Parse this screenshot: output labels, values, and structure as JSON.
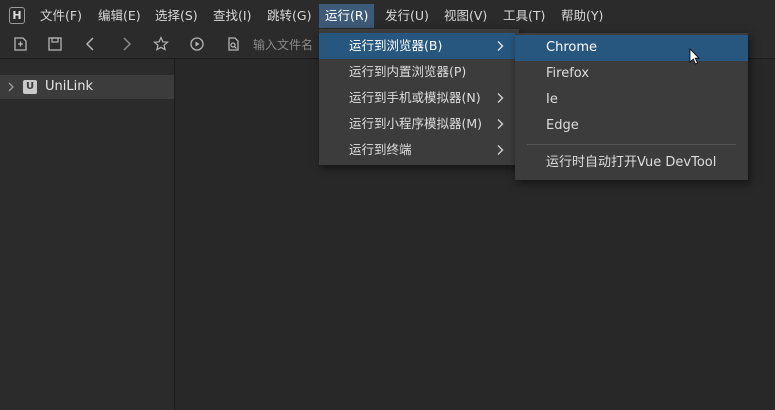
{
  "app": {
    "logo_text": "H"
  },
  "menubar": {
    "items": [
      {
        "label": "文件(F)"
      },
      {
        "label": "编辑(E)"
      },
      {
        "label": "选择(S)"
      },
      {
        "label": "查找(I)"
      },
      {
        "label": "跳转(G)"
      },
      {
        "label": "运行(R)",
        "active": true
      },
      {
        "label": "发行(U)"
      },
      {
        "label": "视图(V)"
      },
      {
        "label": "工具(T)"
      },
      {
        "label": "帮助(Y)"
      }
    ]
  },
  "toolbar": {
    "file_input_placeholder": "输入文件名",
    "icons": [
      "new-file-icon",
      "save-icon",
      "back-icon",
      "forward-icon",
      "star-icon",
      "run-icon",
      "search-file-icon"
    ]
  },
  "sidebar": {
    "project": {
      "name": "UniLink",
      "icon_letter": "U",
      "expanded": false
    }
  },
  "run_menu": {
    "items": [
      {
        "label": "运行到浏览器(B)",
        "has_submenu": true,
        "active": true
      },
      {
        "label": "运行到内置浏览器(P)",
        "has_submenu": false
      },
      {
        "label": "运行到手机或模拟器(N)",
        "has_submenu": true
      },
      {
        "label": "运行到小程序模拟器(M)",
        "has_submenu": true
      },
      {
        "label": "运行到终端",
        "has_submenu": true
      }
    ]
  },
  "browser_submenu": {
    "items": [
      {
        "label": "Chrome",
        "active": true
      },
      {
        "label": "Firefox"
      },
      {
        "label": "Ie"
      },
      {
        "label": "Edge"
      }
    ],
    "devtool_label": "运行时自动打开Vue DevTool"
  },
  "colors": {
    "menu_bg": "#3c3c3c",
    "highlight": "#27577f",
    "editor_bg": "#282828",
    "sidebar_bg": "#2b2b2b"
  }
}
